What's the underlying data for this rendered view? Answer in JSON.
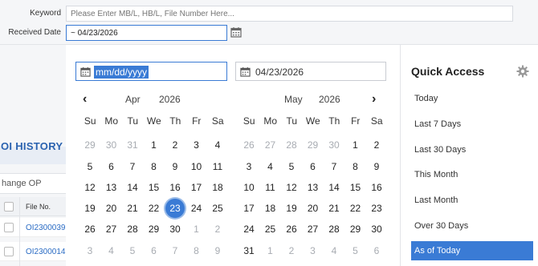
{
  "filters": {
    "keyword_label": "Keyword",
    "keyword_placeholder": "Please Enter MB/L, HB/L, File Number Here...",
    "received_date_label": "Received Date",
    "received_date_value": "~ 04/23/2026"
  },
  "history": {
    "title": "OI HISTORY",
    "input_value": "hange OP",
    "column_file_no": "File No.",
    "rows": [
      "OI2300039",
      "OI2300014"
    ]
  },
  "picker": {
    "start_placeholder": "mm/dd/yyyy",
    "end_value": "04/23/2026",
    "weekdays": [
      "Su",
      "Mo",
      "Tu",
      "We",
      "Th",
      "Fr",
      "Sa"
    ],
    "left_month": {
      "month": "Apr",
      "year": "2026",
      "days": [
        "29",
        "30",
        "31",
        "1",
        "2",
        "3",
        "4",
        "5",
        "6",
        "7",
        "8",
        "9",
        "10",
        "11",
        "12",
        "13",
        "14",
        "15",
        "16",
        "17",
        "18",
        "19",
        "20",
        "21",
        "22",
        "23",
        "24",
        "25",
        "26",
        "27",
        "28",
        "29",
        "30",
        "1",
        "2",
        "3",
        "4",
        "5",
        "6",
        "7",
        "8",
        "9"
      ]
    },
    "right_month": {
      "month": "May",
      "year": "2026",
      "days": [
        "26",
        "27",
        "28",
        "29",
        "30",
        "1",
        "2",
        "3",
        "4",
        "5",
        "6",
        "7",
        "8",
        "9",
        "10",
        "11",
        "12",
        "13",
        "14",
        "15",
        "16",
        "17",
        "18",
        "19",
        "20",
        "21",
        "22",
        "23",
        "24",
        "25",
        "26",
        "27",
        "28",
        "29",
        "30",
        "31",
        "1",
        "2",
        "3",
        "4",
        "5",
        "6"
      ]
    },
    "selected_day": "23"
  },
  "quick_access": {
    "title": "Quick Access",
    "items": [
      "Today",
      "Last 7 Days",
      "Last 30 Days",
      "This Month",
      "Last Month",
      "Over 30 Days",
      "As of Today"
    ],
    "active_item": "As of Today"
  },
  "colors": {
    "accent": "#3a7bd5",
    "link": "#2b6cc4",
    "title_blue": "#2b63b0"
  },
  "icons": {
    "calendar": "calendar-icon",
    "prev": "chevron-left-icon",
    "next": "chevron-right-icon",
    "settings": "gear-icon"
  }
}
